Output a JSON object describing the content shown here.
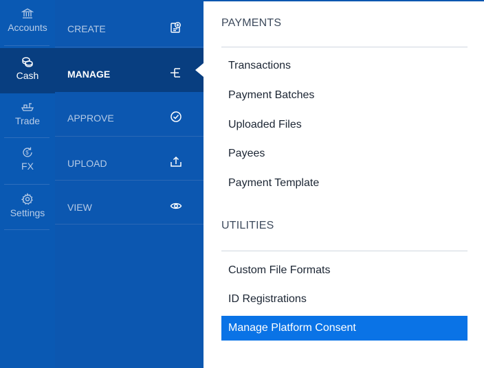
{
  "rail": {
    "items": [
      {
        "label": "Accounts",
        "icon": "bank-icon",
        "active": false
      },
      {
        "label": "Cash",
        "icon": "coins-icon",
        "active": true
      },
      {
        "label": "Trade",
        "icon": "ship-icon",
        "active": false
      },
      {
        "label": "FX",
        "icon": "currency-exchange-icon",
        "active": false
      },
      {
        "label": "Settings",
        "icon": "gear-icon",
        "active": false
      }
    ]
  },
  "menu": {
    "items": [
      {
        "label": "CREATE",
        "icon": "add-document-icon",
        "active": false
      },
      {
        "label": "MANAGE",
        "icon": "hierarchy-icon",
        "active": true
      },
      {
        "label": "APPROVE",
        "icon": "check-circle-icon",
        "active": false
      },
      {
        "label": "UPLOAD",
        "icon": "upload-icon",
        "active": false
      },
      {
        "label": "VIEW",
        "icon": "eye-icon",
        "active": false
      }
    ]
  },
  "content": {
    "payments": {
      "title": "PAYMENTS",
      "links": [
        "Transactions",
        "Payment Batches",
        "Uploaded Files",
        "Payees",
        "Payment Template"
      ]
    },
    "utilities": {
      "title": "UTILITIES",
      "links": [
        "Custom File Formats",
        "ID Registrations",
        "Manage Platform Consent"
      ],
      "selected": "Manage Platform Consent"
    }
  },
  "colors": {
    "rail_bg": "#0a59b3",
    "menu_bg": "#0c57b0",
    "active_bg": "#083e80",
    "selected_link_bg": "#0a73e6"
  }
}
